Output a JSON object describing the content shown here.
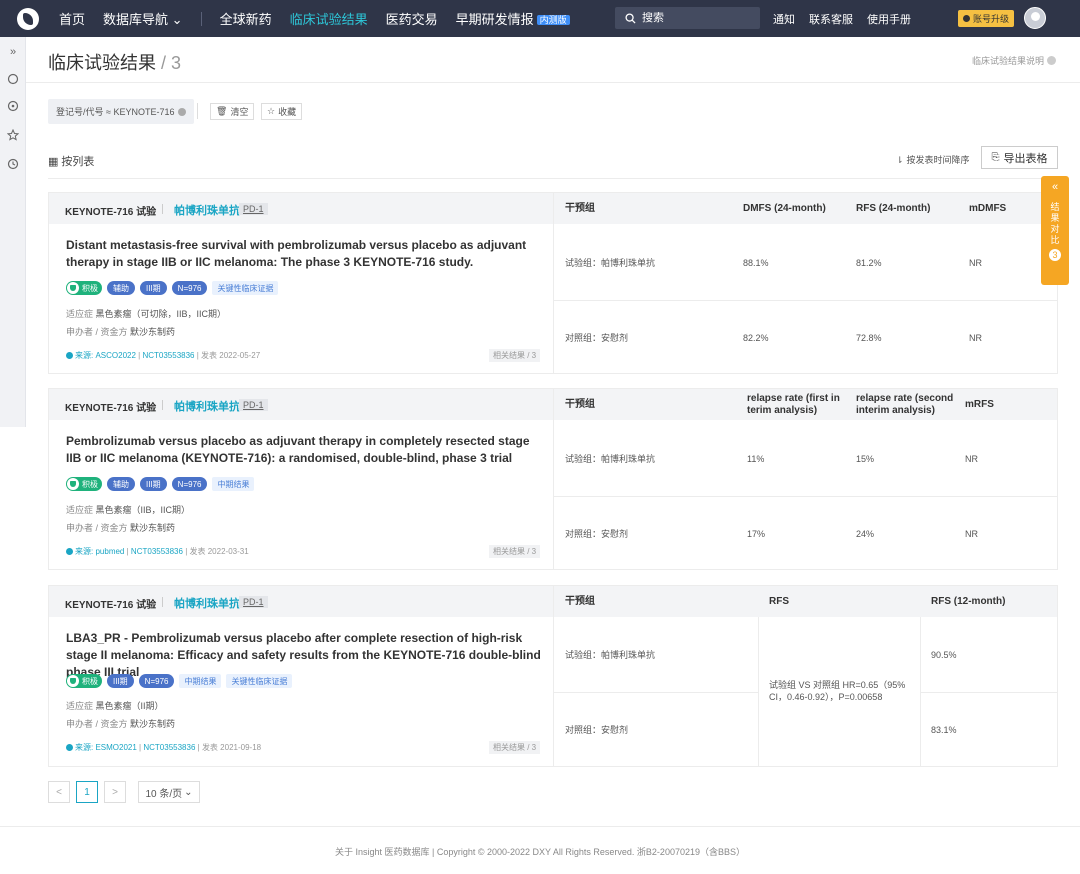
{
  "nav": {
    "items": [
      "首页",
      "数据库导航",
      "全球新药",
      "临床试验结果",
      "医药交易",
      "早期研发情报"
    ],
    "dropdown_arrow": "⌄",
    "internal_badge": "内测版",
    "search_placeholder": "搜索",
    "links": [
      "通知",
      "联系客服",
      "使用手册"
    ],
    "upgrade": "账号升级"
  },
  "sidebar_icons": [
    "collapse-icon",
    "chat-icon",
    "compass-icon",
    "star-icon",
    "clock-icon"
  ],
  "page": {
    "title": "临床试验结果",
    "count_sep": " / ",
    "count": "3",
    "help": "临床试验结果说明"
  },
  "filters": {
    "chip": "登记号/代号 ≈ KEYNOTE-716",
    "clear": "清空",
    "favorite": "收藏"
  },
  "toolbar": {
    "view": "按列表",
    "sort": "按发表时间降序",
    "export": "导出表格"
  },
  "float_panel": {
    "label": "结果对比",
    "count": "3"
  },
  "cards": [
    {
      "trial": "KEYNOTE-716 试验",
      "drug": "帕博利珠单抗",
      "target": "PD-1",
      "columns": [
        "干预组",
        "DMFS (24-month)",
        "RFS (24-month)",
        "mDMFS"
      ],
      "title": "Distant metastasis-free survival with pembrolizumab versus placebo as adjuvant therapy in stage IIB or IIC melanoma: The phase 3 KEYNOTE-716 study.",
      "tag_positive": "积极",
      "tags_blue": [
        "辅助",
        "III期",
        "N=976"
      ],
      "tags_light": [
        "关键性临床证据"
      ],
      "indication_label": "适应症",
      "indication": "黑色素瘤（可切除，IIB，IIC期）",
      "sponsor_label": "申办者 / 资金方",
      "sponsor": "默沙东制药",
      "source_label": "来源:",
      "source": "ASCO2022",
      "nct": "NCT03553836",
      "pub_label": "发表",
      "pub_date": "2022-05-27",
      "related": "相关结果 / 3",
      "rows": [
        [
          "试验组：帕博利珠单抗",
          "88.1%",
          "81.2%",
          "NR"
        ],
        [
          "对照组：安慰剂",
          "82.2%",
          "72.8%",
          "NR"
        ]
      ]
    },
    {
      "trial": "KEYNOTE-716 试验",
      "drug": "帕博利珠单抗",
      "target": "PD-1",
      "columns": [
        "干预组",
        "relapse rate (first in terim analysis)",
        "relapse rate (second interim analysis)",
        "mRFS"
      ],
      "title": "Pembrolizumab versus placebo as adjuvant therapy in completely resected stage IIB or IIC melanoma (KEYNOTE-716): a randomised, double-blind, phase 3 trial",
      "tag_positive": "积极",
      "tags_blue": [
        "辅助",
        "III期",
        "N=976"
      ],
      "tags_light": [
        "中期结果"
      ],
      "indication_label": "适应症",
      "indication": "黑色素瘤（IIB，IIC期）",
      "sponsor_label": "申办者 / 资金方",
      "sponsor": "默沙东制药",
      "source_label": "来源:",
      "source": "pubmed",
      "nct": "NCT03553836",
      "pub_label": "发表",
      "pub_date": "2022-03-31",
      "related": "相关结果 / 3",
      "rows": [
        [
          "试验组：帕博利珠单抗",
          "11%",
          "15%",
          "NR"
        ],
        [
          "对照组：安慰剂",
          "17%",
          "24%",
          "NR"
        ]
      ]
    },
    {
      "trial": "KEYNOTE-716 试验",
      "drug": "帕博利珠单抗",
      "target": "PD-1",
      "columns": [
        "干预组",
        "RFS",
        "RFS (12-month)"
      ],
      "title": "LBA3_PR - Pembrolizumab versus placebo after complete resection of high-risk stage II melanoma: Efficacy and safety results from the KEYNOTE-716 double-blind phase III trial",
      "tag_positive": "积极",
      "tags_blue": [
        "III期",
        "N=976"
      ],
      "tags_light": [
        "中期结果",
        "关键性临床证据"
      ],
      "indication_label": "适应症",
      "indication": "黑色素瘤（II期）",
      "sponsor_label": "申办者 / 资金方",
      "sponsor": "默沙东制药",
      "source_label": "来源:",
      "source": "ESMO2021",
      "nct": "NCT03553836",
      "pub_label": "发表",
      "pub_date": "2021-09-18",
      "related": "相关结果 / 3",
      "merged": "试验组 VS 对照组 HR=0.65（95% CI，0.46-0.92），P=0.00658",
      "rows": [
        [
          "试验组：帕博利珠单抗",
          "90.5%"
        ],
        [
          "对照组：安慰剂",
          "83.1%"
        ]
      ]
    }
  ],
  "pagination": {
    "prev": "<",
    "page": "1",
    "next": ">",
    "size": "10 条/页"
  },
  "footer": "关于 Insight 医药数据库 | Copyright © 2000-2022 DXY All Rights Reserved. 浙B2-20070219（含BBS）"
}
